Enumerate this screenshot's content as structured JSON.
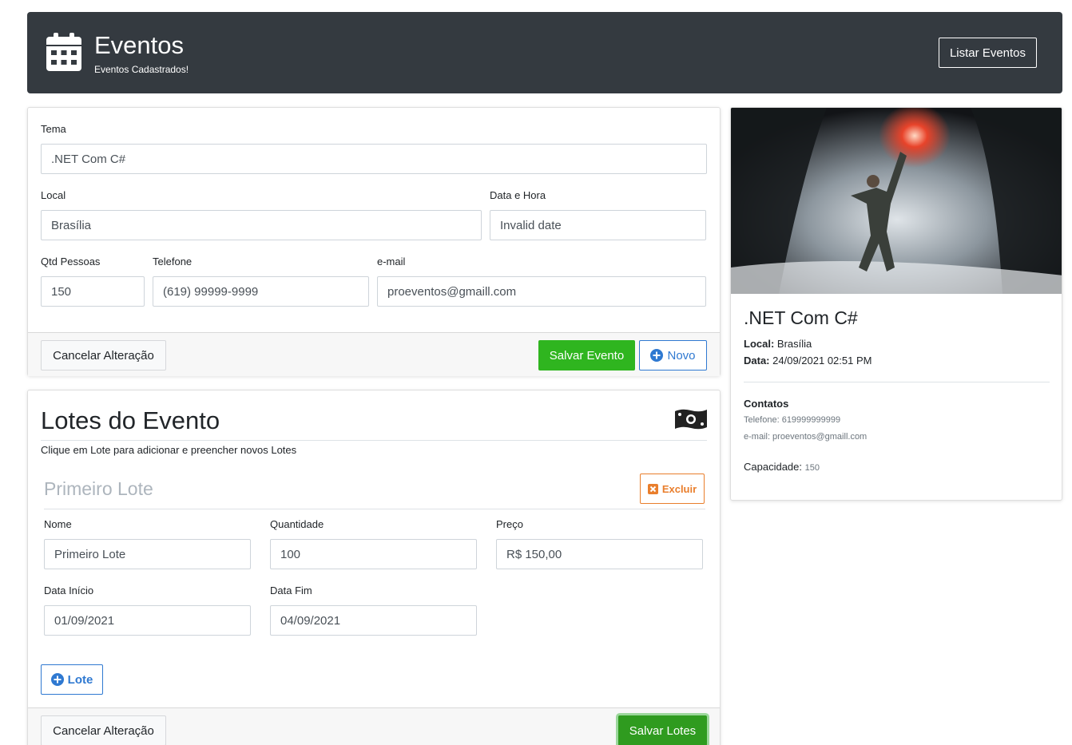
{
  "header": {
    "title": "Eventos",
    "subtitle": "Eventos Cadastrados!",
    "list_button": "Listar Eventos",
    "icon": "calendar-icon"
  },
  "event_form": {
    "tema_label": "Tema",
    "tema_value": ".NET Com C#",
    "local_label": "Local",
    "local_value": "Brasília",
    "data_label": "Data e Hora",
    "data_value": "Invalid date",
    "qtd_label": "Qtd Pessoas",
    "qtd_value": "150",
    "telefone_label": "Telefone",
    "telefone_value": "(619) 99999-9999",
    "email_label": "e-mail",
    "email_value": "proeventos@gmaill.com",
    "cancel_button": "Cancelar Alteração",
    "save_button": "Salvar Evento",
    "new_button": "Novo"
  },
  "lotes": {
    "title": "Lotes do Evento",
    "hint": "Clique em Lote para adicionar e preencher novos Lotes",
    "icon": "money-bill-icon",
    "items": [
      {
        "heading": "Primeiro Lote",
        "delete_button": "Excluir",
        "nome_label": "Nome",
        "nome_value": "Primeiro Lote",
        "quantidade_label": "Quantidade",
        "quantidade_value": "100",
        "preco_label": "Preço",
        "preco_value": "R$ 150,00",
        "inicio_label": "Data Início",
        "inicio_value": "01/09/2021",
        "fim_label": "Data Fim",
        "fim_value": "04/09/2021"
      }
    ],
    "add_button": "Lote",
    "cancel_button": "Cancelar Alteração",
    "save_button": "Salvar Lotes"
  },
  "preview": {
    "title": ".NET Com C#",
    "local_label": "Local:",
    "local_value": "Brasília",
    "data_label": "Data:",
    "data_value": "24/09/2021 02:51 PM",
    "contatos_label": "Contatos",
    "telefone": "Telefone: 619999999999",
    "email": "e-mail: proeventos@gmaill.com",
    "capacidade_label": "Capacidade:",
    "capacidade_value": "150"
  },
  "colors": {
    "header_bg": "#343a40",
    "success": "#2fb51f",
    "primary": "#2f79d1",
    "warning": "#e97e2c"
  }
}
